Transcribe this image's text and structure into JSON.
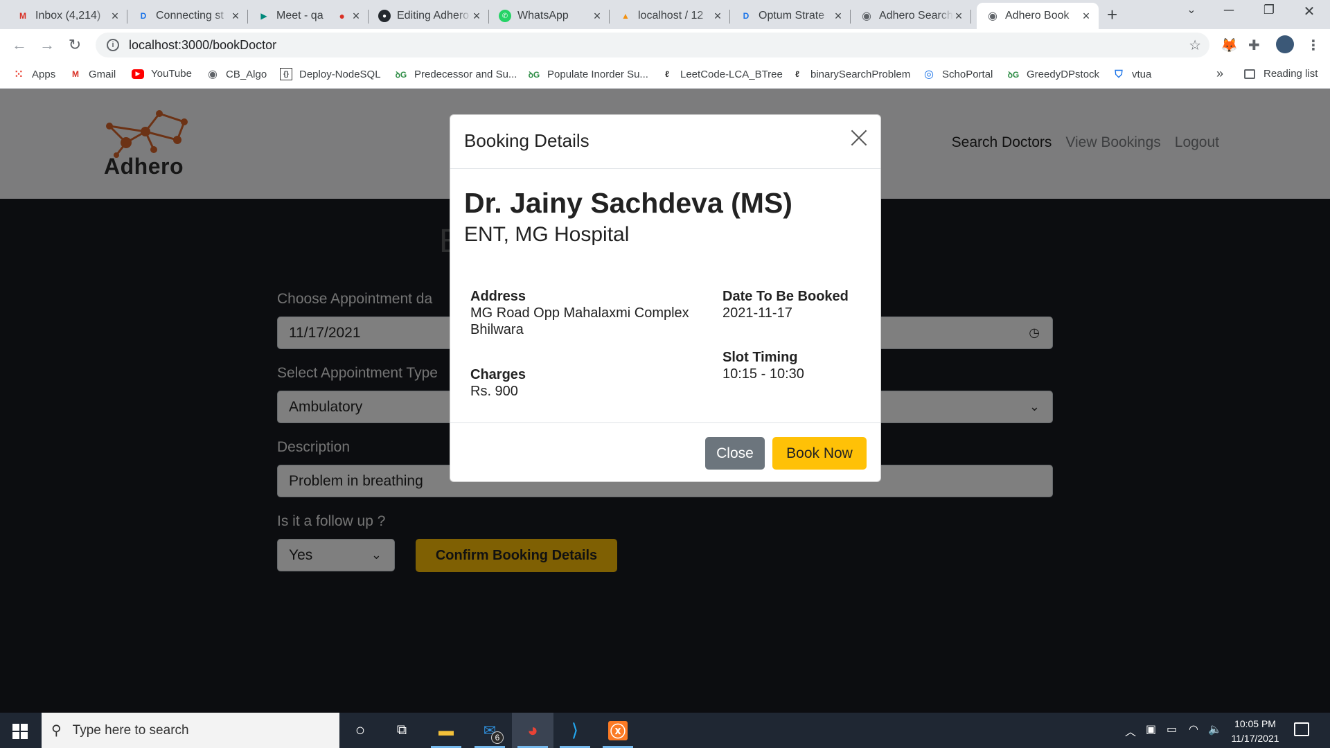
{
  "browser": {
    "tabs": [
      {
        "title": "Inbox (4,214)",
        "icon": "gmail-icon",
        "color": "#d93025",
        "glyph": "M"
      },
      {
        "title": "Connecting st",
        "icon": "dc-icon",
        "color": "#1a73e8",
        "glyph": "D"
      },
      {
        "title": "Meet - qa",
        "icon": "meet-icon",
        "color": "#00897b",
        "glyph": "▶"
      },
      {
        "title": "Editing Adhero",
        "icon": "github-icon",
        "color": "#24292e",
        "glyph": "●"
      },
      {
        "title": "WhatsApp",
        "icon": "whatsapp-icon",
        "color": "#25d366",
        "glyph": "●"
      },
      {
        "title": "localhost / 12",
        "icon": "phpmyadmin-icon",
        "color": "#f29111",
        "glyph": "▲"
      },
      {
        "title": "Optum Strate",
        "icon": "dc-icon",
        "color": "#1a73e8",
        "glyph": "D"
      },
      {
        "title": "Adhero Search",
        "icon": "globe-icon",
        "color": "#5f6368",
        "glyph": "◉"
      },
      {
        "title": "Adhero Book",
        "icon": "globe-icon",
        "color": "#5f6368",
        "glyph": "◉"
      }
    ],
    "url": "localhost:3000/bookDoctor",
    "bookmarks": [
      {
        "label": "Apps",
        "icon": "apps-grid-icon"
      },
      {
        "label": "Gmail",
        "icon": "gmail-icon"
      },
      {
        "label": "YouTube",
        "icon": "youtube-icon"
      },
      {
        "label": "CB_Algo",
        "icon": "globe-icon"
      },
      {
        "label": "Deploy-NodeSQL",
        "icon": "code-icon"
      },
      {
        "label": "Predecessor and Su...",
        "icon": "gfg-icon"
      },
      {
        "label": "Populate Inorder Su...",
        "icon": "gfg-icon"
      },
      {
        "label": "LeetCode-LCA_BTree",
        "icon": "leetcode-icon"
      },
      {
        "label": "binarySearchProblem",
        "icon": "leetcode-icon"
      },
      {
        "label": "SchoPortal",
        "icon": "portal-icon"
      },
      {
        "label": "GreedyDPstock",
        "icon": "gfg-icon"
      },
      {
        "label": "vtua",
        "icon": "shield-icon"
      }
    ],
    "more_bookmarks": "»",
    "reading_list": "Reading list"
  },
  "site": {
    "brand": "Adhero",
    "nav": [
      "Search Doctors",
      "View Bookings",
      "Logout"
    ],
    "heading": "B",
    "form": {
      "date_label": "Choose Appointment da",
      "date_value": "11/17/2021",
      "type_label": "Select Appointment Type",
      "type_value": "Ambulatory",
      "desc_label": "Description",
      "desc_value": "Problem in breathing",
      "followup_label": "Is it a follow up ?",
      "followup_value": "Yes",
      "confirm_label": "Confirm Booking Details"
    }
  },
  "modal": {
    "title": "Booking Details",
    "doctor_name": "Dr. Jainy Sachdeva (MS)",
    "specialty": "ENT, MG Hospital",
    "address_label": "Address",
    "address_line1": "MG Road Opp Mahalaxmi Complex",
    "address_line2": "Bhilwara",
    "date_label": "Date To Be Booked",
    "date_value": "2021-11-17",
    "slot_label": "Slot Timing",
    "slot_value": "10:15 - 10:30",
    "charges_label": "Charges",
    "charges_value": "Rs. 900",
    "close_label": "Close",
    "book_label": "Book Now"
  },
  "taskbar": {
    "search_placeholder": "Type here to search",
    "mail_badge": "6",
    "time": "10:05 PM",
    "date": "11/17/2021"
  },
  "colors": {
    "accent": "#ffc107",
    "secondary_button": "#6c757d",
    "logo_orange": "#d9652a"
  }
}
